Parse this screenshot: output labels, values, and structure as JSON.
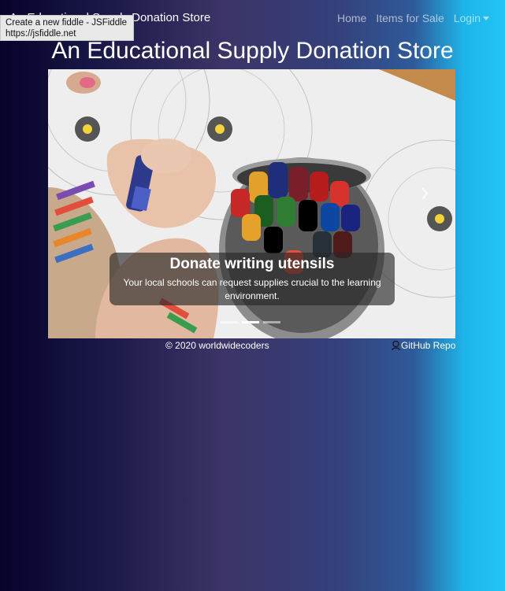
{
  "navbar": {
    "brand": "An Educational Supply Donation Store",
    "links": [
      "Home",
      "Items for Sale",
      "Login"
    ]
  },
  "tooltip": {
    "line1": "Create a new fiddle - JSFiddle",
    "line2": "https://jsfiddle.net"
  },
  "page_title": "An Educational Supply Donation Store",
  "carousel": {
    "caption_title": "Donate writing utensils",
    "caption_text": "Your local schools can request supplies crucial to the learning environment.",
    "slide_count": 3,
    "active_index": 1
  },
  "footer": {
    "copyright": "© 2020 worldwidecoders",
    "repo_link": "GitHub Repo"
  },
  "colors": {
    "bg_left": "#05032a",
    "bg_mid": "#3c3467",
    "bg_right": "#22c4f6"
  }
}
